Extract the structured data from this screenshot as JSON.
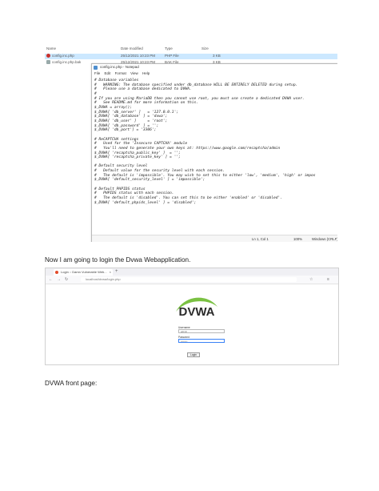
{
  "explorer": {
    "headers": {
      "name": "Name",
      "date_modified": "Date modified",
      "type": "Type",
      "size": "Size"
    },
    "files": [
      {
        "name": "config.inc.php",
        "date": "25/12/2021 10:23 PM",
        "type": "PHP File",
        "size": "3 KB"
      },
      {
        "name": "config.inc.php.bak",
        "date": "25/12/2021 10:23 PM",
        "type": "BAK File",
        "size": "3 KB"
      }
    ]
  },
  "notepad": {
    "title": "config.inc.php - Notepad",
    "menu": [
      "File",
      "Edit",
      "Format",
      "View",
      "Help"
    ],
    "lines": [
      "# Database variables",
      "#   WARNING: The database specified under db_database WILL BE ENTIRELY DELETED during setup.",
      "#   Please use a database dedicated to DVWA.",
      "#",
      "# If you are using MariaDB then you cannot use root, you must use create a dedicated DVWA user.",
      "#   See README.md for more information on this.",
      "$_DVWA = array();",
      "$_DVWA[ 'db_server' ]   = '127.0.0.1';",
      "$_DVWA[ 'db_database' ] = 'dvwa';",
      "$_DVWA[ 'db_user' ]     = 'root';",
      "$_DVWA[ 'db_password' ] = '';",
      "$_DVWA[ 'db_port'] = '3306';",
      "",
      "# ReCAPTCHA settings",
      "#   Used for the 'Insecure CAPTCHA' module",
      "#   You'll need to generate your own keys at: https://www.google.com/recaptcha/admin",
      "$_DVWA[ 'recaptcha_public_key' ]  = '';",
      "$_DVWA[ 'recaptcha_private_key' ] = '';",
      "",
      "# Default security level",
      "#   Default value for the security level with each session.",
      "#   The default is 'impossible'. You may wish to set this to either 'low', 'medium', 'high' or impos",
      "$_DVWA[ 'default_security_level' ] = 'impossible';",
      "",
      "# Default PHPIDS status",
      "#   PHPIDS status with each session.",
      "#   The default is 'disabled'. You can set this to be either 'enabled' or 'disabled'.",
      "$_DVWA[ 'default_phpids_level' ] = 'disabled';"
    ],
    "status": {
      "position": "Ln 1, Col 1",
      "zoom": "100%",
      "encoding": "Windows (CRLF)"
    }
  },
  "captions": {
    "login": "Now I am going to login the Dvwa Webapplication.",
    "front_page": "DVWA front page:"
  },
  "browser": {
    "tab_title": "Login :: Damn Vulnerable Web...",
    "url": "localhost/dvwa/login.php"
  },
  "dvwa_login": {
    "logo_text": "DVWA",
    "username_label": "Username",
    "username_value": "admin",
    "password_label": "Password",
    "password_value": "••••••••",
    "login_button": "Login"
  },
  "colors": {
    "logo_green": "#7ac142",
    "logo_dark": "#2b2b2b",
    "selection_blue": "#cce8ff",
    "focus_blue": "#3b82f6"
  }
}
